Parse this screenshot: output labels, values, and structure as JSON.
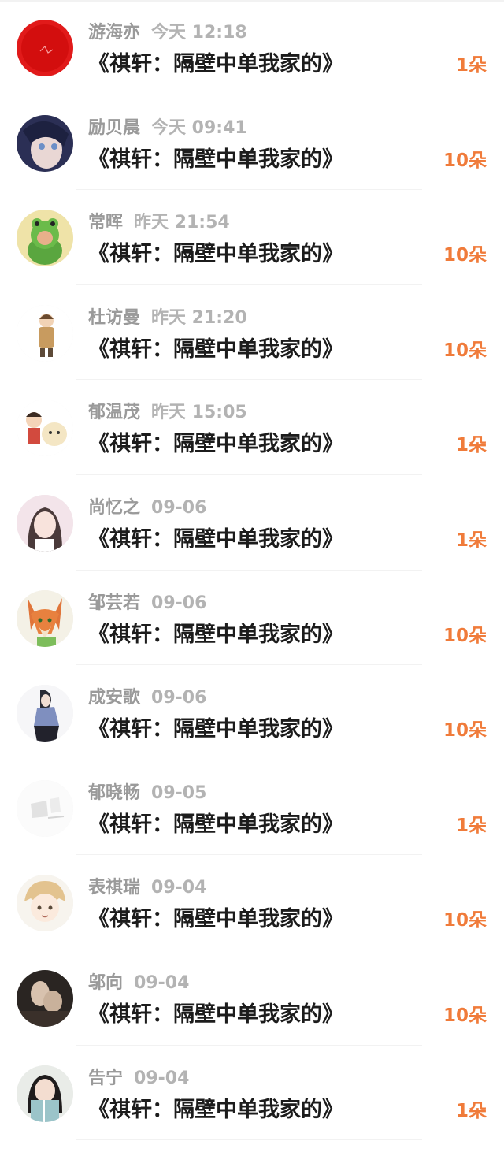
{
  "gift_records": [
    {
      "name": "游海亦",
      "time": "今天 12:18",
      "title": "《祺轩：隔壁中单我家的》",
      "count": "1朵",
      "avatar": "red-circle-avatar"
    },
    {
      "name": "励贝晨",
      "time": "今天 09:41",
      "title": "《祺轩：隔壁中单我家的》",
      "count": "10朵",
      "avatar": "anime-girl-avatar"
    },
    {
      "name": "常晖",
      "time": "昨天 21:54",
      "title": "《祺轩：隔壁中单我家的》",
      "count": "10朵",
      "avatar": "frog-costume-avatar"
    },
    {
      "name": "杜访曼",
      "time": "昨天 21:20",
      "title": "《祺轩：隔壁中单我家的》",
      "count": "10朵",
      "avatar": "cartoon-boy-avatar"
    },
    {
      "name": "郁温茂",
      "time": "昨天 15:05",
      "title": "《祺轩：隔壁中单我家的》",
      "count": "1朵",
      "avatar": "cartoon-couple-avatar"
    },
    {
      "name": "尚忆之",
      "time": "09-06",
      "title": "《祺轩：隔壁中单我家的》",
      "count": "1朵",
      "avatar": "girl-photo-avatar"
    },
    {
      "name": "邹芸若",
      "time": "09-06",
      "title": "《祺轩：隔壁中单我家的》",
      "count": "10朵",
      "avatar": "fox-avatar"
    },
    {
      "name": "成安歌",
      "time": "09-06",
      "title": "《祺轩：隔壁中单我家的》",
      "count": "10朵",
      "avatar": "girl-figure-avatar"
    },
    {
      "name": "郁晓畅",
      "time": "09-05",
      "title": "《祺轩：隔壁中单我家的》",
      "count": "1朵",
      "avatar": "faded-white-avatar"
    },
    {
      "name": "表祺瑞",
      "time": "09-04",
      "title": "《祺轩：隔壁中单我家的》",
      "count": "10朵",
      "avatar": "anime-boy-avatar"
    },
    {
      "name": "邬向",
      "time": "09-04",
      "title": "《祺轩：隔壁中单我家的》",
      "count": "10朵",
      "avatar": "hands-dark-avatar"
    },
    {
      "name": "告宁",
      "time": "09-04",
      "title": "《祺轩：隔壁中单我家的》",
      "count": "1朵",
      "avatar": "girl-book-avatar"
    }
  ],
  "colors": {
    "name": "#9a9a9a",
    "time": "#b3b3b3",
    "title": "#1c1c1c",
    "gift_count": "#f07b3a"
  }
}
